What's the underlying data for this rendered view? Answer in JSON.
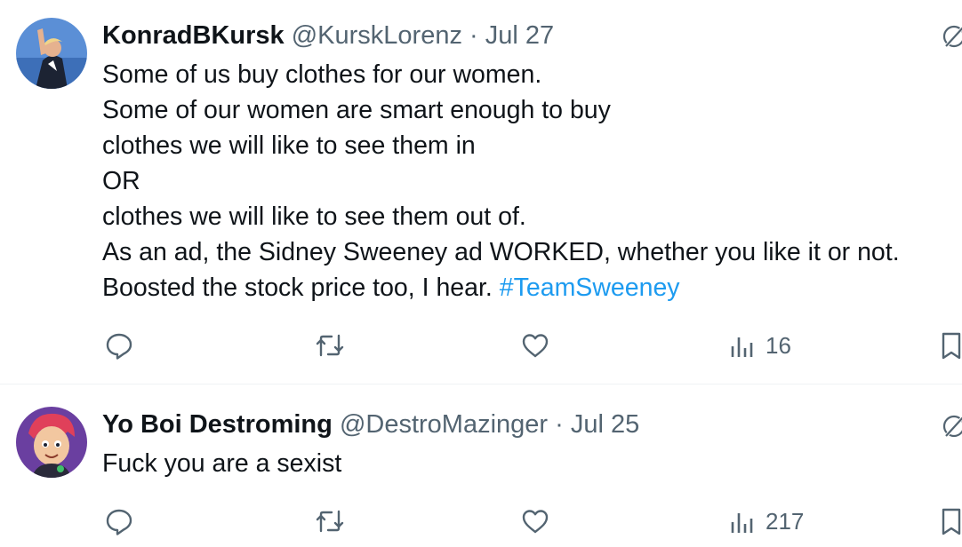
{
  "tweets": [
    {
      "display_name": "KonradBKursk",
      "handle": "@KurskLorenz",
      "separator": "·",
      "date": "Jul 27",
      "avatar": "avatar-photo",
      "lines": [
        "Some of us buy clothes for our women.",
        "Some of our women are smart enough to buy",
        "clothes we will like to see them in",
        "OR",
        "clothes we will like to see them out of.",
        "As an ad, the Sidney Sweeney ad WORKED, whether you like it or not."
      ],
      "last_line_text": "Boosted the stock price too, I hear. ",
      "hashtag": "#TeamSweeney",
      "actions": {
        "reply_icon": "reply-icon",
        "retweet_icon": "retweet-icon",
        "like_icon": "like-icon",
        "views_icon": "views-icon",
        "views_count": "16",
        "bookmark_icon": "bookmark-icon"
      }
    },
    {
      "display_name": "Yo Boi Destroming",
      "handle": "@DestroMazinger",
      "separator": "·",
      "date": "Jul 25",
      "avatar": "avatar-cartoon",
      "lines": [
        "Fuck you are a sexist"
      ],
      "actions": {
        "reply_icon": "reply-icon",
        "retweet_icon": "retweet-icon",
        "like_icon": "like-icon",
        "views_icon": "views-icon",
        "views_count": "217",
        "bookmark_icon": "bookmark-icon"
      }
    }
  ],
  "colors": {
    "text": "#0f1419",
    "secondary": "#536471",
    "link": "#1d9bf0",
    "divider": "#eff3f4"
  }
}
